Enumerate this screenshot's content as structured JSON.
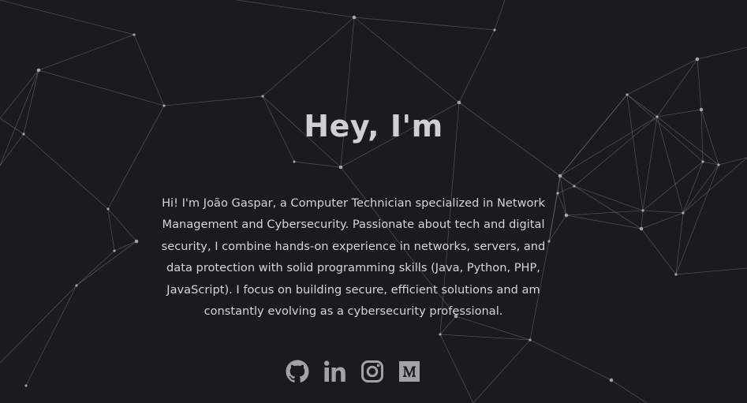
{
  "hero": {
    "title": "Hey, I'm",
    "bio": "Hi! I'm João Gaspar, a Computer Technician specialized in Network Management and Cybersecurity. Passionate about tech and digital security, I combine hands-on experience in networks, servers, and data protection with solid programming skills (Java, Python, PHP, JavaScript). I focus on building secure, efficient solutions and am constantly evolving as a cybersecurity professional."
  },
  "socials": [
    {
      "icon": "github-icon"
    },
    {
      "icon": "linkedin-icon"
    },
    {
      "icon": "instagram-icon"
    },
    {
      "icon": "medium-icon"
    }
  ],
  "colors": {
    "background": "#1c1a20",
    "title": "#cfd0d6",
    "text": "#d4d4d9",
    "icon": "#a2a2a8",
    "network_line": "#8a8a90",
    "network_node": "#b8b8bd"
  }
}
